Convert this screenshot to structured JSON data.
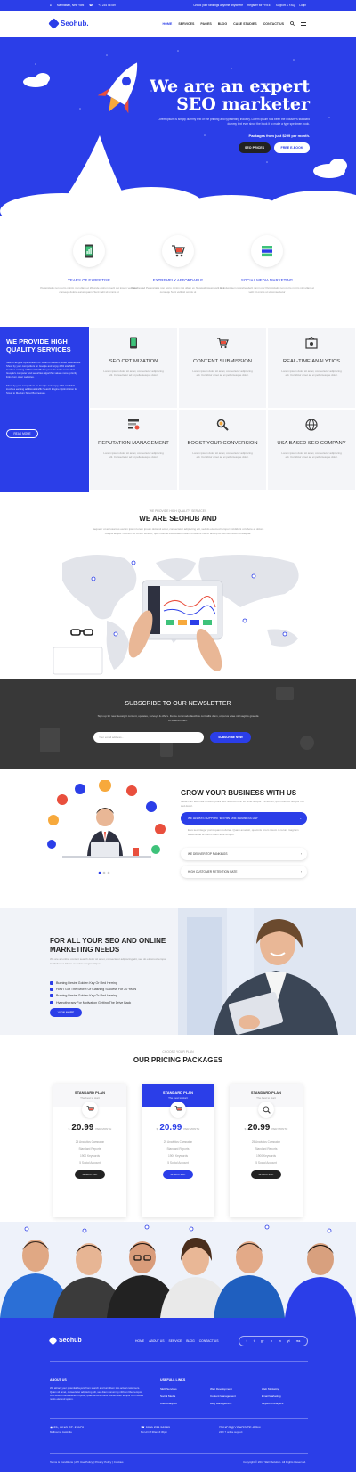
{
  "topbar": {
    "location": "Manhattan, New York",
    "phone": "+1 234 56789",
    "links": [
      "Check your rankings anytime anywhere",
      "Register for FREE!",
      "Support & FAQ",
      "Login"
    ]
  },
  "header": {
    "brand": "Seohub.",
    "nav": [
      "HOME",
      "SERVICES",
      "PAGES",
      "BLOG",
      "CASE STUDIES",
      "CONTACT US"
    ]
  },
  "hero": {
    "title_line1": "We are an expert",
    "title_line2": "SEO marketer",
    "text": "Lorem Ipsum is simply dummy text of the printing and typesetting industry. Lorem Ipsum has been the industry's standard dummy text ever since the book it to make a type specimen book.",
    "price_line": "Packages from just $299 per month.",
    "btn_primary": "SEO PRICES",
    "btn_secondary": "FREE E-BOOK"
  },
  "features": [
    {
      "title": "YEARS OF EXPERTISE",
      "text": "Perspiciatis non porro minim nisi ullam et 20 unde ostrum fuerit qui ipsum velit sed consequ dolore earumquam. Sunt velit sit omnis ut"
    },
    {
      "title": "EXTREMELY AFFORDABLE",
      "text": "Valorres ad Perspiciatis non porro minim nisi ullam et. Nepquid ipsum velit sed consequ Sunt velit sit omnis ut"
    },
    {
      "title": "SOCIAL MEDIA MARKETING",
      "text": "Ut voluptatem reprehenderit mmm per Perspiciatis non porro minim nisi ullam et velit sit omnis ut ut consectetur"
    }
  ],
  "services_intro": {
    "title": "WE PROVIDE HIGH QUALITY SERVICES",
    "para1": "Search Engine Optimization for Small to Medium Sized Businesses. Show by your competitors on Google and enjoy 29% site SEO involves earning additional traffic for your site is the sense that Google's computer and securities algorithm values more, priority links from other websites.",
    "para2": "Show by your competitors on Google and enjoy 10% site SEO involves earning additional traffic Search Engine Optimization for Small to Medium Sized Businesses.",
    "btn": "READ MORE"
  },
  "services": [
    {
      "title": "SEO OPTIMIZATION",
      "text": "Lorem ipsum dolor sit amet, consectetur adipiscing elit. Consectetur ad et pellentesque dolor."
    },
    {
      "title": "CONTENT SUBMISSION",
      "text": "Lorem ipsum dolor sit amet, consectetur adipiscing elit. Curabitur amet ad et pellentesque dolor."
    },
    {
      "title": "REAL-TIME ANALYTICS",
      "text": "Lorem ipsum dolor sit amet, consectetur adipiscing elit. Curabitur amet ad et pellentesque dolor."
    },
    {
      "title": "REPUTATION MANAGEMENT",
      "text": "Lorem ipsum dolor sit amet, consectetur adipiscing elit. Consectetur ad et pellentesque dolor."
    },
    {
      "title": "BOOST YOUR CONVERSION",
      "text": "Lorem ipsum dolor sit amet, consectetur adipiscing elit. Curabitur amet ad et pellentesque dolor."
    },
    {
      "title": "USA BASED SEO COMPANY",
      "text": "Lorem ipsum dolor sit amet, consectetur adipiscing elit. Curabitur amet ad et pellentesque dolor."
    }
  ],
  "seohub": {
    "kicker": "WE PROVIDE HIGH QUALITY SERVICES",
    "title": "WE ARE SEOHUB AND",
    "text": "Nequeur ut accusamus earum ipsum lorem ipsum dolor sit amet, consectetur adipiscing elit, sed do eiusmod tempor incididunt ut labore et dolore magna aliqua. Ut enim ad minim veniam, quis nostrud exercitation ullamco laboris nisi ut aliquip ex ea commodo consequat."
  },
  "newsletter": {
    "title": "SUBSCRIBE TO OUR NEWSLETTER",
    "text": "Sign up for new Seosight content, updates, surveys & offers. Fusce commodo faucibus convallis diam, ut purus vitae nisl sagittis gravida et ut amet diam.",
    "placeholder": "Your email address...",
    "btn": "SUBSCRIBE NOW"
  },
  "grow": {
    "title": "GROW YOUR BUSINESS WITH US",
    "lead": "Mutat cum eos mea in doctri plura sed nostrud nunc sit amet tempor. Pervenen, quo nostrum tempor nisl sed doctri.",
    "items": [
      {
        "label": "WE ALWAYS SUPPORT WITHIN ONE BUSINESS DAY",
        "text": "Eius sed integer porro quam pulvinar. Quam amet sit, quamnis lorem ipsum in rerum magnam scelerisque at ipsum dolor ante tempor."
      },
      {
        "label": "WE DELIVER TOP RANKINGS"
      },
      {
        "label": "HIGH CUSTOMER RETENTION RATE"
      }
    ]
  },
  "marketing": {
    "title": "FOR ALL YOUR SEO AND ONLINE MARKETING NEEDS",
    "lead": "We are all online content search dolor sit amet, consectetur adipiscing elit, sed do eiusmod tempor incididunt ut labore et dolore magna aliqua.",
    "bullets": [
      "Burning Desire Golden Key Or Red Herring",
      "How I Got The Secret Of Clashing Success For 20 Years",
      "Burning Desire Golden Key Or Red Herring",
      "Hypnotherapy For Motivation Getting The Drive Back"
    ],
    "btn": "VIEW MORE"
  },
  "pricing": {
    "kicker": "CHOOSE YOUR PLAN",
    "title": "OUR PRICING PACKAGES",
    "plans": [
      {
        "name": "STANDARD PLAN",
        "sub": "The best to start",
        "currency": "$",
        "price": "20.99",
        "period": "PER MONTH",
        "features": [
          "25 Analytics Campaign",
          "Standard Reports",
          "1900 Keywords",
          "5 Social Account"
        ],
        "btn": "PURCHASE"
      },
      {
        "name": "STANDARD PLAN",
        "sub": "The best to start",
        "currency": "$",
        "price": "20.99",
        "period": "PER MONTH",
        "features": [
          "25 Analytics Campaign",
          "Standard Reports",
          "1900 Keywords",
          "5 Social Account"
        ],
        "btn": "PURCHASE"
      },
      {
        "name": "STANDARD PLAN",
        "sub": "The best to start",
        "currency": "$",
        "price": "20.99",
        "period": "PER MONTH",
        "features": [
          "25 Analytics Campaign",
          "Standard Reports",
          "1900 Keywords",
          "5 Social Account"
        ],
        "btn": "PURCHASE"
      }
    ]
  },
  "footer": {
    "brand": "Seohub",
    "nav": [
      "HOME",
      "ABOUT US",
      "SERVICE",
      "BLOG",
      "CONTACT US"
    ],
    "social": [
      "f",
      "t",
      "g+",
      "p",
      "in",
      "yt",
      "rss"
    ],
    "about_title": "ABOUT US",
    "about_text": "We attract your potential buyers from search and turn them into actual customers. Quam sit amet, consectetur adipiscing elit, sed diam nonummy nibham liber tempor cum soluta nobis eleifend option, quae sincera nobis nibham liber tempor cum soluta nobis eleifend option.",
    "useful_title": "USEFULL LINKS",
    "links_col1": [
      "SEO Services",
      "Social Media",
      "Web Analytics"
    ],
    "links_col2": [
      "Web Development",
      "Content Management",
      "Blog Management"
    ],
    "links_col3": [
      "Web Marketing",
      "Email Marketing",
      "Keyword Analytics"
    ],
    "address": "25, KING ST. 20170",
    "address_sub": "Melbourne Australia",
    "phone": "0011 234 56789",
    "phone_sub": "Mon-Fri 8:30am-6:30pm",
    "email": "INFO@YOURSITE.COM",
    "email_sub": "24 X 7 online support",
    "bottom_links": [
      "Terms & Conditions",
      "API Use Policy",
      "Privacy Policy",
      "Cookies"
    ],
    "copyright": "Copyright © 2017 SEO Solution. All Rights Reserved."
  },
  "colors": {
    "primary": "#2b3ee8",
    "dark": "#383838",
    "light": "#f4f5f8"
  }
}
